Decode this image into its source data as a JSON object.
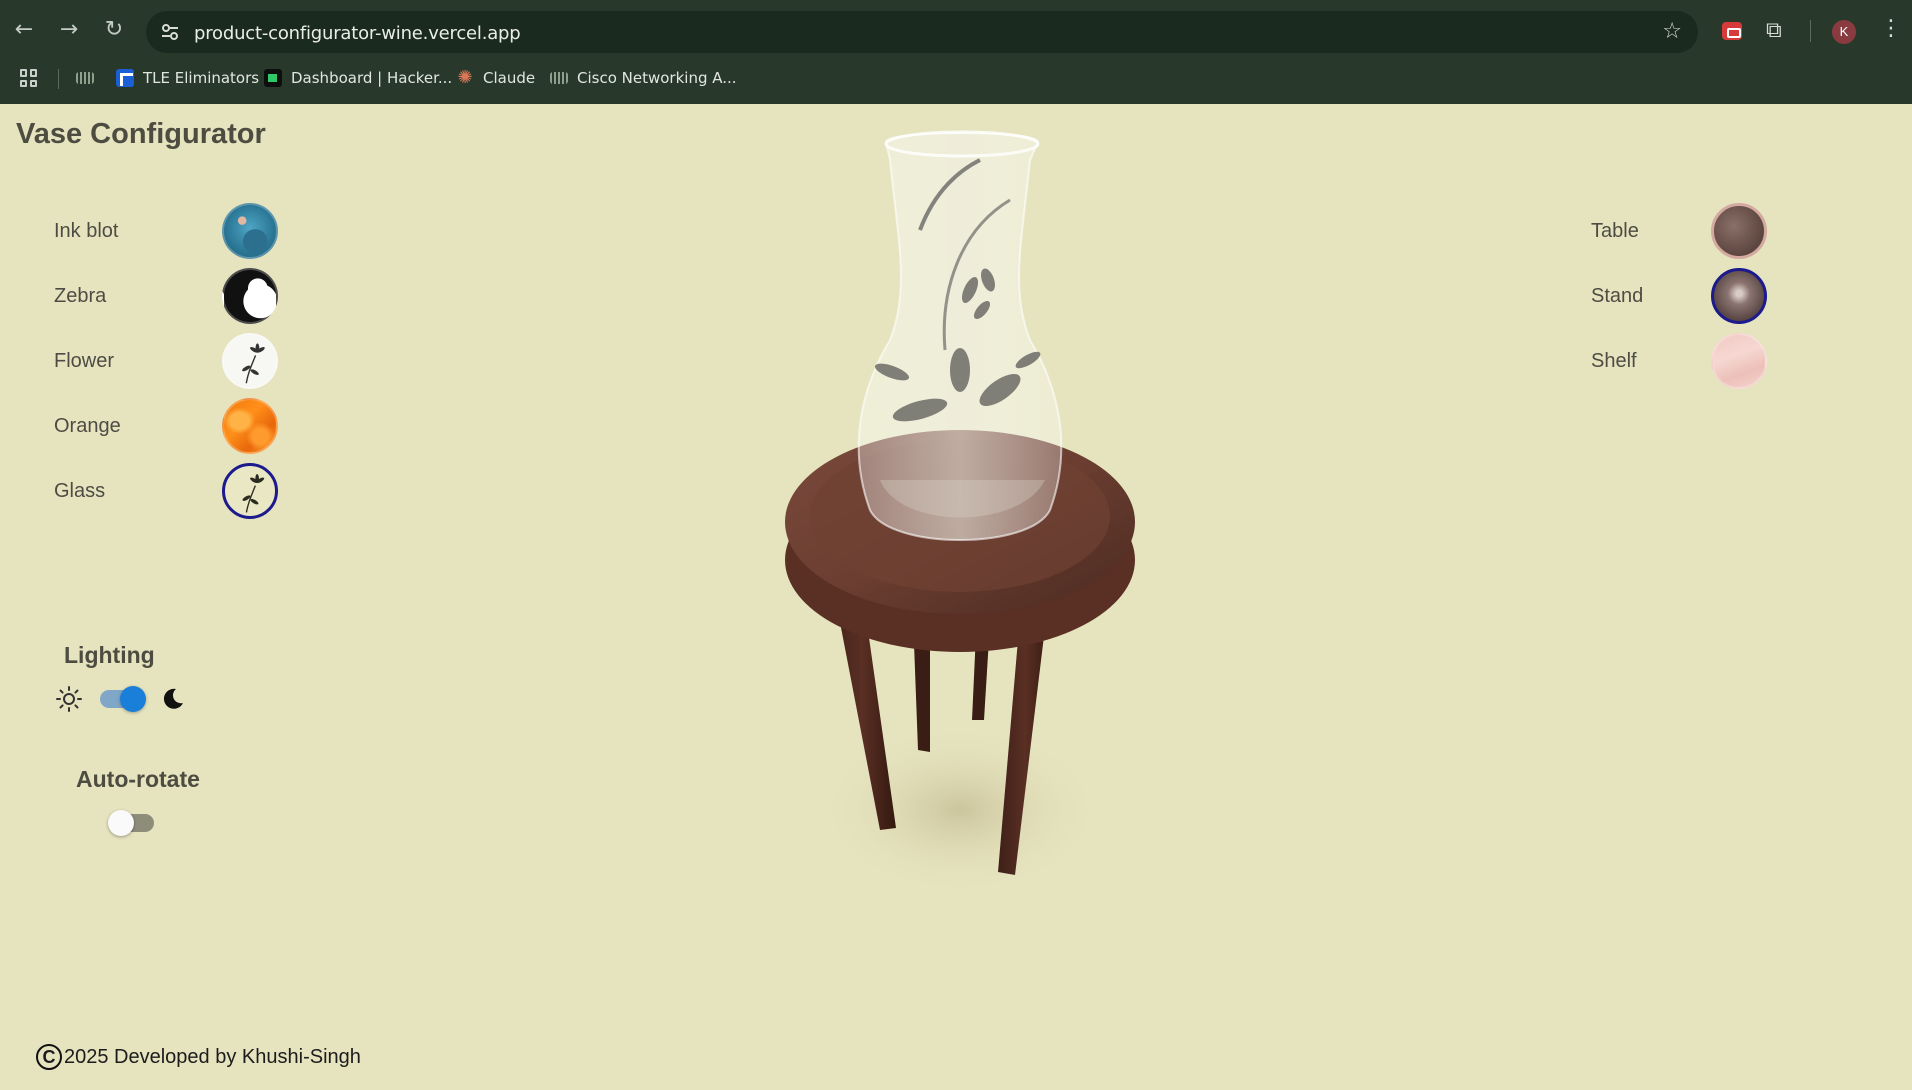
{
  "browser": {
    "url": "product-configurator-wine.vercel.app",
    "profile_initial": "K",
    "bookmarks": [
      {
        "label": ""
      },
      {
        "label": "TLE Eliminators"
      },
      {
        "label": "Dashboard | Hacker..."
      },
      {
        "label": "Claude"
      },
      {
        "label": "Cisco Networking A..."
      }
    ]
  },
  "app": {
    "title": "Vase Configurator",
    "vase_materials": [
      {
        "label": "Ink blot",
        "selected": false
      },
      {
        "label": "Zebra",
        "selected": false
      },
      {
        "label": "Flower",
        "selected": false
      },
      {
        "label": "Orange",
        "selected": false
      },
      {
        "label": "Glass",
        "selected": true
      }
    ],
    "stand_materials": [
      {
        "label": "Table",
        "selected": false
      },
      {
        "label": "Stand",
        "selected": true
      },
      {
        "label": "Shelf",
        "selected": false
      }
    ],
    "lighting": {
      "title": "Lighting",
      "dark_mode": true
    },
    "auto_rotate": {
      "title": "Auto-rotate",
      "enabled": false
    },
    "footer": {
      "symbol": "C",
      "text": "2025 Developed by Khushi-Singh"
    }
  },
  "colors": {
    "page_background": "#e6e4bf",
    "selected_ring": "#1c1a8c",
    "toggle_accent": "#1a7fd8"
  }
}
